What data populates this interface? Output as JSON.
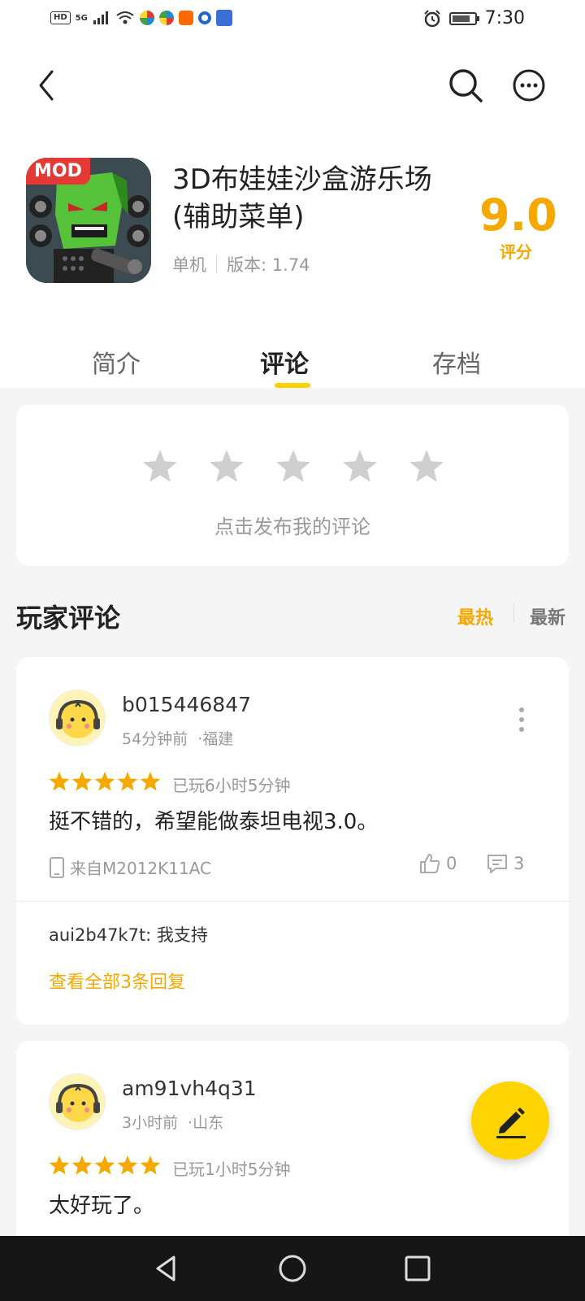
{
  "status_bar": {
    "left_badges": [
      "HD",
      "5G"
    ],
    "time": "7:30",
    "battery_level": 0.8
  },
  "topbar": {
    "icons": [
      "back-arrow-icon",
      "search-icon",
      "more-icon"
    ]
  },
  "app": {
    "title": "3D布娃娃沙盒游乐场(辅助菜单)",
    "icon_badge": "MOD",
    "type": "单机",
    "version": "版本: 1.74",
    "score": "9.0",
    "score_label": "评分"
  },
  "tabs": [
    {
      "label": "简介",
      "active": false
    },
    {
      "label": "评论",
      "active": true
    },
    {
      "label": "存档",
      "active": false
    }
  ],
  "rate_box": {
    "star_count": 5,
    "prompt": "点击发布我的评论"
  },
  "comments_section": {
    "title": "玩家评论",
    "sort_hot": "最热",
    "sort_new": "最新"
  },
  "reviews": [
    {
      "username": "b015446847",
      "time": "54分钟前",
      "location": "·福建",
      "rating": 5,
      "played": "已玩6小时5分钟",
      "text": "挺不错的，希望能做泰坦电视3.0。",
      "device": "来自M2012K11AC",
      "likes": "0",
      "comments": "3",
      "reply": "aui2b47k7t: 我支持",
      "view_all": "查看全部3条回复"
    },
    {
      "username": "am91vh4q31",
      "time": "3小时前",
      "location": "·山东",
      "rating": 5,
      "played": "已玩1小时5分钟",
      "text": "太好玩了。"
    }
  ],
  "colors": {
    "accent": "#f5a800",
    "tab_indicator": "#ffd000",
    "fab": "#ffd400",
    "navbar": "#161616"
  }
}
